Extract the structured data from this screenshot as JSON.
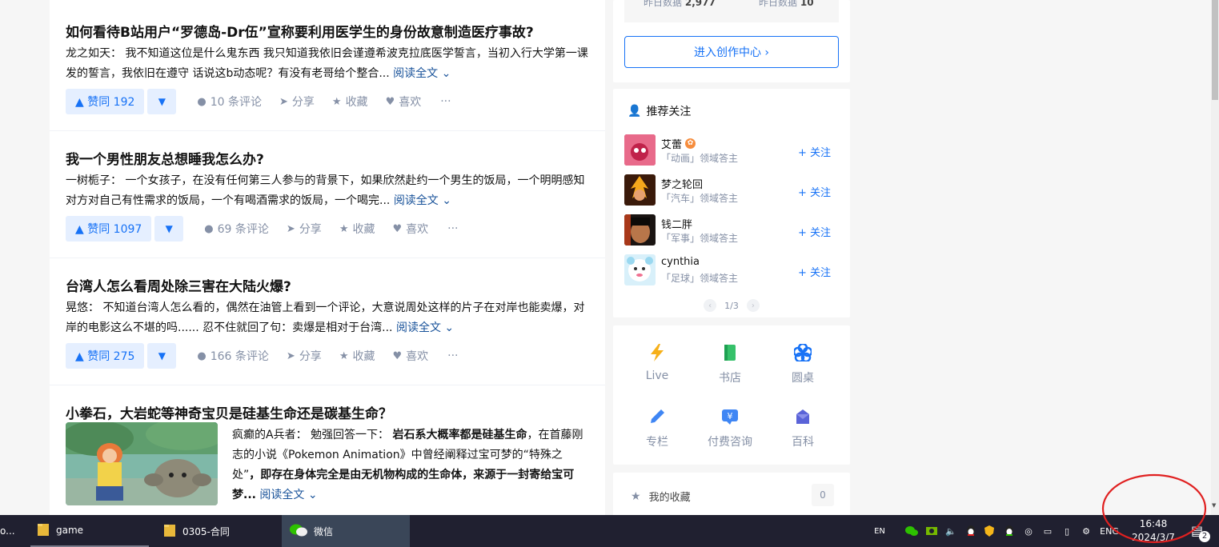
{
  "feed": {
    "items": [
      {
        "title": "如何看待B站用户“罗德岛-Dr伍”宣称要利用医学生的身份故意制造医疗事故?",
        "author": "龙之如天：",
        "excerpt": "我不知道这位是什么鬼东西 我只知道我依旧会谨遵希波克拉底医学誓言，当初入行大学第一课发的誓言，我依旧在遵守 话说这b动态呢？有没有老哥给个整合...",
        "read_more": "阅读全文 ⌄",
        "upvote": "▲ 赞同 192",
        "comments": "10 条评论",
        "share": "分享",
        "collect": "收藏",
        "like": "喜欢",
        "more": "···"
      },
      {
        "title": "我一个男性朋友总想睡我怎么办?",
        "author": "一树栀子：",
        "excerpt": "一个女孩子，在没有任何第三人参与的背景下，如果欣然赴约一个男生的饭局，一个明明感知对方对自己有性需求的饭局，一个有喝酒需求的饭局，一个喝完...",
        "read_more": "阅读全文 ⌄",
        "upvote": "▲ 赞同 1097",
        "comments": "69 条评论",
        "share": "分享",
        "collect": "收藏",
        "like": "喜欢",
        "more": "···"
      },
      {
        "title": "台湾人怎么看周处除三害在大陆火爆?",
        "author": "晃悠：",
        "excerpt": "不知道台湾人怎么看的，偶然在油管上看到一个评论，大意说周处这样的片子在对岸也能卖爆，对岸的电影这么不堪的吗...... 忍不住就回了句：卖爆是相对于台湾...",
        "read_more": "阅读全文 ⌄",
        "upvote": "▲ 赞同 275",
        "comments": "166 条评论",
        "share": "分享",
        "collect": "收藏",
        "like": "喜欢",
        "more": "···"
      },
      {
        "title": "小拳石，大岩蛇等神奇宝贝是硅基生命还是碳基生命？",
        "author": "疯癫的A兵者：",
        "excerpt_plain": "勉强回答一下：",
        "excerpt_bold1": "岩石系大概率都是硅基生命",
        "excerpt_mid": "，在首藤刚志的小说《Pokemon Animation》中曾经阐释过宝可梦的“特殊之处”",
        "excerpt_bold2": "，即存在身体完全是由无机物构成的生命体，来源于一封寄给宝可梦...",
        "read_more": "阅读全文 ⌄"
      }
    ]
  },
  "sidebar": {
    "stats": {
      "left_label": "昨日数据",
      "left_value": "2,977",
      "right_label": "昨日数据",
      "right_value": "10"
    },
    "creation_button": "进入创作中心 ›",
    "recommend": {
      "title": "推荐关注",
      "follow_label": "+ 关注",
      "users": [
        {
          "name": "艾蕾",
          "desc": "「动画」领域答主"
        },
        {
          "name": "梦之轮回",
          "desc": "「汽车」领域答主"
        },
        {
          "name": "钱二胖",
          "desc": "「军事」领域答主"
        },
        {
          "name": "cynthia",
          "desc": "「足球」领域答主"
        }
      ],
      "pager": "1/3"
    },
    "tools": [
      {
        "label": "Live",
        "color": "#f6b019"
      },
      {
        "label": "书店",
        "color": "#36c16a"
      },
      {
        "label": "圆桌",
        "color": "#1772f6"
      },
      {
        "label": "专栏",
        "color": "#3f86f4"
      },
      {
        "label": "付费咨询",
        "color": "#3f86f4"
      },
      {
        "label": "百科",
        "color": "#5a63d8"
      }
    ],
    "favorites": {
      "label": "我的收藏",
      "count": "0"
    }
  },
  "taskbar": {
    "start_fragment": "o...",
    "items": [
      "game",
      "0305-合同",
      "微信"
    ],
    "ime_left": "EN",
    "ime_right": "ENG",
    "time": "16:48",
    "date": "2024/3/7",
    "notification_count": "2"
  },
  "colors": {
    "accent": "#1772f6",
    "taskbar": "#202030",
    "annotation": "#e02020"
  }
}
